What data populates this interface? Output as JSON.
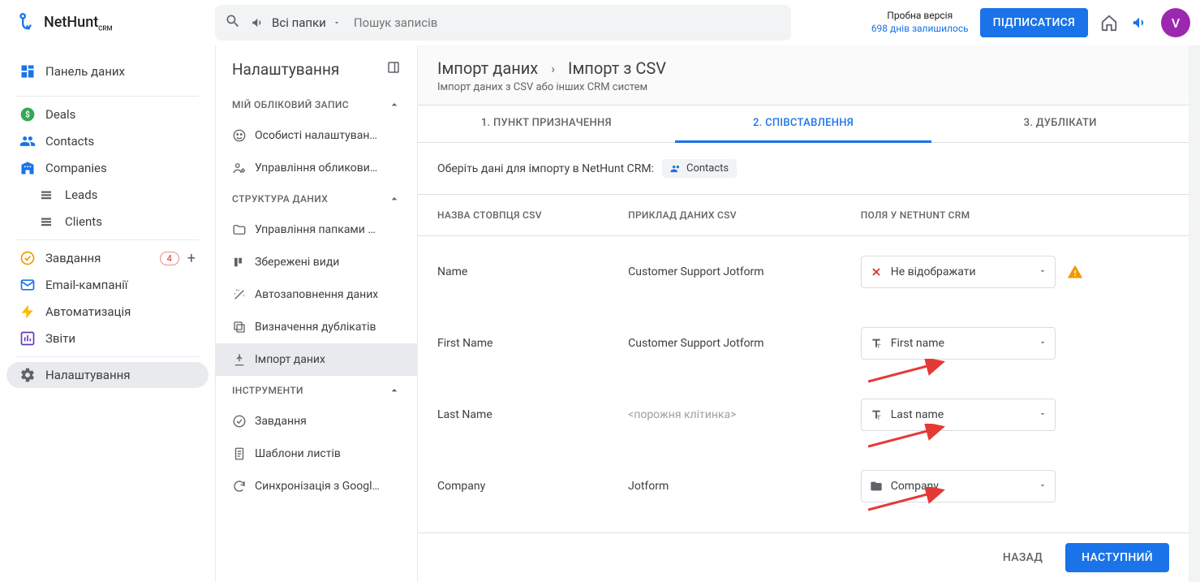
{
  "header": {
    "logo_text": "NetHunt",
    "logo_sub": "CRM",
    "search_scope": "Всі папки",
    "search_placeholder": "Пошук записів",
    "trial_line1": "Пробна версія",
    "trial_line2": "698 днів залишилось",
    "subscribe": "ПІДПИСАТИСЯ",
    "avatar_initial": "V"
  },
  "sidebar": {
    "items": [
      {
        "label": "Панель даних"
      },
      {
        "label": "Deals"
      },
      {
        "label": "Contacts"
      },
      {
        "label": "Companies"
      },
      {
        "label": "Leads"
      },
      {
        "label": "Clients"
      },
      {
        "label": "Завдання",
        "badge": "4"
      },
      {
        "label": "Email-кампанії"
      },
      {
        "label": "Автоматизація"
      },
      {
        "label": "Звіти"
      },
      {
        "label": "Налаштування"
      }
    ]
  },
  "settings_panel": {
    "title": "Налаштування",
    "groups": [
      {
        "title": "МІЙ ОБЛІКОВИЙ ЗАПИС",
        "items": [
          "Особисті налаштуван…",
          "Управління обликови…"
        ]
      },
      {
        "title": "СТРУКТУРА ДАНИХ",
        "items": [
          "Управління папками …",
          "Збережені види",
          "Автозаповнення даних",
          "Визначення дублікатів",
          "Імпорт даних"
        ],
        "active_index": 4
      },
      {
        "title": "ІНСТРУМЕНТИ",
        "items": [
          "Завдання",
          "Шаблони листів",
          "Синхронізація з Googl…"
        ]
      }
    ]
  },
  "main": {
    "breadcrumb_root": "Імпорт даних",
    "breadcrumb_current": "Імпорт з CSV",
    "subtitle": "Імпорт даних з CSV або інших CRM систем",
    "tabs": [
      "1. ПУНКТ ПРИЗНАЧЕННЯ",
      "2. СПІВСТАВЛЕННЯ",
      "3. ДУБЛІКАТИ"
    ],
    "active_tab": 1,
    "pickline": "Оберіть дані для імпорту в NetHunt CRM:",
    "chip_label": "Contacts",
    "columns": [
      "НАЗВА СТОВПЦЯ CSV",
      "ПРИКЛАД ДАНИХ CSV",
      "ПОЛЯ У NETHUNT CRM"
    ],
    "rows": [
      {
        "csv_name": "Name",
        "example": "Customer Support Jotform",
        "field": {
          "icon": "close",
          "label": "Не відображати",
          "warn": true
        }
      },
      {
        "csv_name": "First Name",
        "example": "Customer Support Jotform",
        "field": {
          "icon": "text",
          "label": "First name"
        }
      },
      {
        "csv_name": "Last Name",
        "example": "<порожня клітинка>",
        "empty": true,
        "field": {
          "icon": "text",
          "label": "Last name"
        }
      },
      {
        "csv_name": "Company",
        "example": "Jotform",
        "field": {
          "icon": "folder",
          "label": "Company"
        }
      }
    ],
    "footer": {
      "back": "НАЗАД",
      "next": "НАСТУПНИЙ"
    }
  }
}
